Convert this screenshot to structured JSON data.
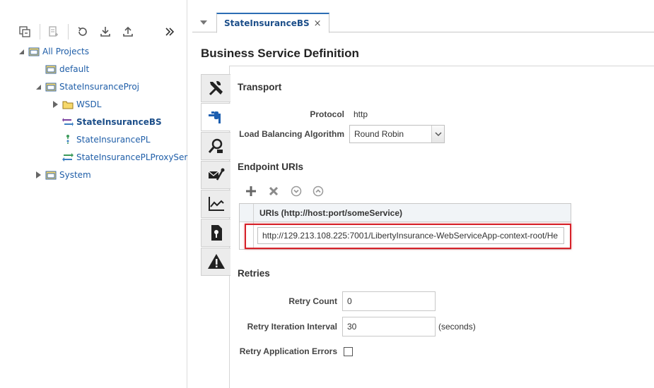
{
  "navigator": {
    "toolbar": [
      {
        "name": "collapse-all-icon"
      },
      {
        "name": "new-document-icon"
      },
      {
        "name": "refresh-icon"
      },
      {
        "name": "import-icon"
      },
      {
        "name": "export-icon"
      },
      {
        "name": "expand-panel-icon"
      }
    ],
    "tree": [
      {
        "label": "All Projects",
        "expanded": true
      },
      {
        "label": "default"
      },
      {
        "label": "StateInsuranceProj",
        "expanded": true
      },
      {
        "label": "WSDL",
        "expanded": false
      },
      {
        "label": "StateInsuranceBS",
        "selected": true
      },
      {
        "label": "StateInsurancePL"
      },
      {
        "label": "StateInsurancePLProxySer"
      },
      {
        "label": "System",
        "expanded": false
      }
    ]
  },
  "editor": {
    "tab": {
      "label": "StateInsuranceBS",
      "close": "×"
    },
    "page_title": "Business Service Definition",
    "vertical_tabs": [
      {
        "name": "configuration-tab-icon"
      },
      {
        "name": "transport-tab-icon",
        "active": true
      },
      {
        "name": "transport-details-tab-icon"
      },
      {
        "name": "message-handling-tab-icon"
      },
      {
        "name": "performance-tab-icon"
      },
      {
        "name": "security-tab-icon"
      },
      {
        "name": "alert-tab-icon"
      }
    ],
    "transport": {
      "title": "Transport",
      "protocol_label": "Protocol",
      "protocol_value": "http",
      "lb_label": "Load Balancing Algorithm",
      "lb_value": "Round Robin"
    },
    "endpoints": {
      "title": "Endpoint URIs",
      "column_header": "URIs (http://host:port/someService)",
      "uri_value": "http://129.213.108.225:7001/LibertyInsurance-WebServiceApp-context-root/He"
    },
    "retries": {
      "title": "Retries",
      "retry_count_label": "Retry Count",
      "retry_count_value": "0",
      "interval_label": "Retry Iteration Interval",
      "interval_value": "30",
      "interval_unit": "(seconds)",
      "app_errors_label": "Retry Application Errors",
      "app_errors_checked": false
    }
  },
  "colors": {
    "accent": "#2c6db4",
    "highlight_border": "#d6222a",
    "link_text": "#1f5ea8"
  }
}
